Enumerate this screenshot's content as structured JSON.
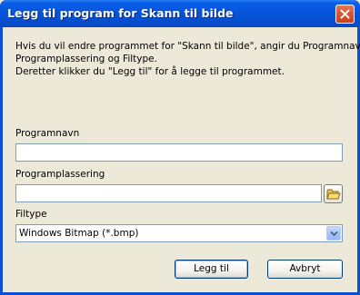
{
  "window": {
    "title": "Legg til program for Skann til bilde"
  },
  "instructions": {
    "line1": "Hvis du vil endre programmet for \"Skann til bilde\", angir du Programnavn,",
    "line2": "Programplassering og Filtype.",
    "line3": "Deretter klikker du \"Legg til\" for å legge til programmet."
  },
  "fields": {
    "program_name_label": "Programnavn",
    "program_name_value": "",
    "program_location_label": "Programplassering",
    "program_location_value": "",
    "file_type_label": "Filtype",
    "file_type_selected": "Windows Bitmap (*.bmp)"
  },
  "buttons": {
    "add": "Legg til",
    "cancel": "Avbryt"
  },
  "icons": {
    "close": "close-x-icon",
    "browse": "folder-icon",
    "dropdown": "chevron-down-icon"
  },
  "colors": {
    "titlebar": "#0654db",
    "dialog_background": "#ece9d8",
    "input_border": "#7f9db9",
    "close_button": "#d35a36"
  }
}
